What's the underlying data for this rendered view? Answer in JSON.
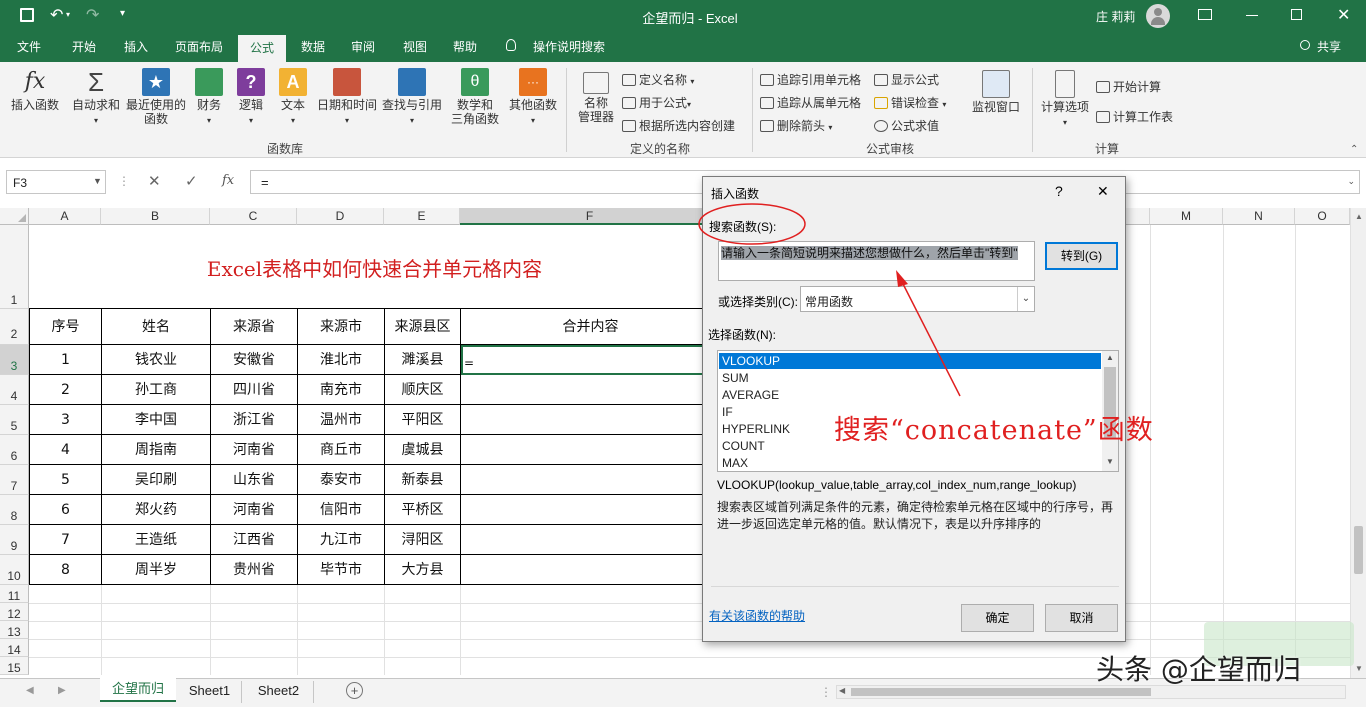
{
  "window": {
    "title": "企望而归  -  Excel",
    "user": "庄 莉莉"
  },
  "tabs": [
    "文件",
    "开始",
    "插入",
    "页面布局",
    "公式",
    "数据",
    "审阅",
    "视图",
    "帮助",
    "操作说明搜索"
  ],
  "share_label": "共享",
  "ribbon": {
    "library": {
      "group_label": "函数库",
      "buttons": [
        "插入函数",
        "自动求和",
        "最近使用的\n函数",
        "财务",
        "逻辑",
        "文本",
        "日期和时间",
        "查找与引用",
        "数学和\n三角函数",
        "其他函数"
      ]
    },
    "names": {
      "group_label": "定义的名称",
      "manager": "名称\n管理器",
      "items": [
        "定义名称",
        "用于公式",
        "根据所选内容创建"
      ]
    },
    "audit": {
      "group_label": "公式审核",
      "col1": [
        "追踪引用单元格",
        "追踪从属单元格",
        "删除箭头"
      ],
      "col2": [
        "显示公式",
        "错误检查",
        "公式求值"
      ],
      "watch": "监视窗口"
    },
    "calc": {
      "group_label": "计算",
      "options": "计算选项",
      "items": [
        "开始计算",
        "计算工作表"
      ]
    }
  },
  "formula_bar": {
    "name_box": "F3",
    "fx": "fx",
    "content": "="
  },
  "sheet": {
    "columns": [
      "A",
      "B",
      "C",
      "D",
      "E",
      "F",
      "",
      "",
      "",
      "",
      "",
      "M",
      "N",
      "O"
    ],
    "row_numbers": [
      "1",
      "2",
      "3",
      "4",
      "5",
      "6",
      "7",
      "8",
      "9",
      "10",
      "11",
      "12",
      "13",
      "14",
      "15"
    ],
    "title": "Excel表格中如何快速合并单元格内容",
    "headers": [
      "序号",
      "姓名",
      "来源省",
      "来源市",
      "来源县区",
      "合并内容"
    ],
    "rows": [
      [
        "1",
        "钱农业",
        "安徽省",
        "淮北市",
        "濉溪县",
        "="
      ],
      [
        "2",
        "孙工商",
        "四川省",
        "南充市",
        "顺庆区",
        ""
      ],
      [
        "3",
        "李中国",
        "浙江省",
        "温州市",
        "平阳区",
        ""
      ],
      [
        "4",
        "周指南",
        "河南省",
        "商丘市",
        "虞城县",
        ""
      ],
      [
        "5",
        "吴印刷",
        "山东省",
        "泰安市",
        "新泰县",
        ""
      ],
      [
        "6",
        "郑火药",
        "河南省",
        "信阳市",
        "平桥区",
        ""
      ],
      [
        "7",
        "王造纸",
        "江西省",
        "九江市",
        "浔阳区",
        ""
      ],
      [
        "8",
        "周半岁",
        "贵州省",
        "毕节市",
        "大方县",
        ""
      ]
    ]
  },
  "sheet_tabs": [
    "企望而归",
    "Sheet1",
    "Sheet2"
  ],
  "dialog": {
    "title": "插入函数",
    "help_glyph": "?",
    "close_glyph": "✕",
    "search_label": "搜索函数(S):",
    "search_value": "请输入一条简短说明来描述您想做什么，然后单击\"转到\"",
    "go_button": "转到(G)",
    "category_label": "或选择类别(C):",
    "category_value": "常用函数",
    "list_label": "选择函数(N):",
    "functions": [
      "VLOOKUP",
      "SUM",
      "AVERAGE",
      "IF",
      "HYPERLINK",
      "COUNT",
      "MAX"
    ],
    "selected_function": "VLOOKUP",
    "signature": "VLOOKUP(lookup_value,table_array,col_index_num,range_lookup)",
    "description": "搜索表区域首列满足条件的元素，确定待检索单元格在区域中的行序号，再进一步返回选定单元格的值。默认情况下，表是以升序排序的",
    "help_link": "有关该函数的帮助",
    "ok": "确定",
    "cancel": "取消"
  },
  "annotation": "搜索“concatenate”函数",
  "watermark": "头条 @企望而归",
  "colors": {
    "excel_green": "#217346",
    "annotation_red": "#e02020",
    "selection_blue": "#0078d7"
  }
}
